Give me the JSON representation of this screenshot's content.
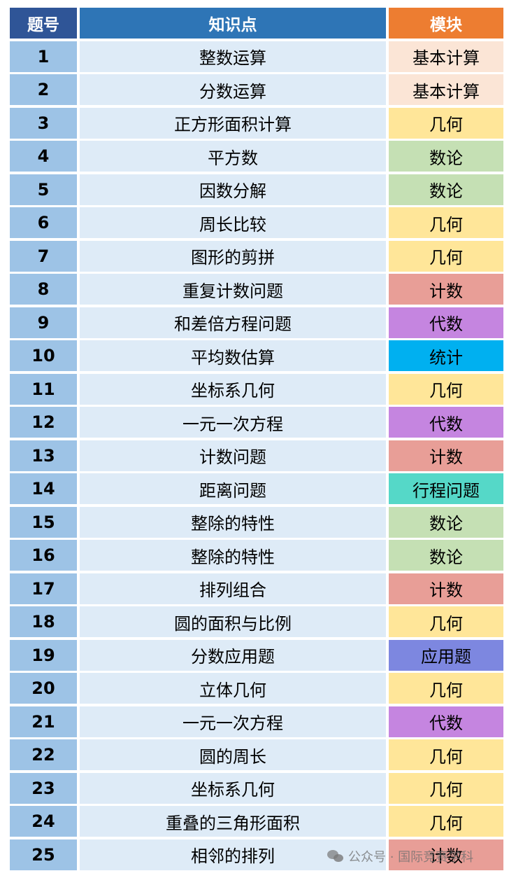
{
  "header": {
    "number": "题号",
    "topic": "知识点",
    "module": "模块"
  },
  "module_colors": {
    "基本计算": "#fbe5d6",
    "几何": "#ffe699",
    "数论": "#c5e0b4",
    "计数": "#e89e97",
    "代数": "#c585e0",
    "统计": "#00b0f0",
    "行程问题": "#55d8c8",
    "应用题": "#7d87e0"
  },
  "rows": [
    {
      "number": "1",
      "topic": "整数运算",
      "module": "基本计算"
    },
    {
      "number": "2",
      "topic": "分数运算",
      "module": "基本计算"
    },
    {
      "number": "3",
      "topic": "正方形面积计算",
      "module": "几何"
    },
    {
      "number": "4",
      "topic": "平方数",
      "module": "数论"
    },
    {
      "number": "5",
      "topic": "因数分解",
      "module": "数论"
    },
    {
      "number": "6",
      "topic": "周长比较",
      "module": "几何"
    },
    {
      "number": "7",
      "topic": "图形的剪拼",
      "module": "几何"
    },
    {
      "number": "8",
      "topic": "重复计数问题",
      "module": "计数"
    },
    {
      "number": "9",
      "topic": "和差倍方程问题",
      "module": "代数"
    },
    {
      "number": "10",
      "topic": "平均数估算",
      "module": "统计"
    },
    {
      "number": "11",
      "topic": "坐标系几何",
      "module": "几何"
    },
    {
      "number": "12",
      "topic": "一元一次方程",
      "module": "代数"
    },
    {
      "number": "13",
      "topic": "计数问题",
      "module": "计数"
    },
    {
      "number": "14",
      "topic": "距离问题",
      "module": "行程问题"
    },
    {
      "number": "15",
      "topic": "整除的特性",
      "module": "数论"
    },
    {
      "number": "16",
      "topic": "整除的特性",
      "module": "数论"
    },
    {
      "number": "17",
      "topic": "排列组合",
      "module": "计数"
    },
    {
      "number": "18",
      "topic": "圆的面积与比例",
      "module": "几何"
    },
    {
      "number": "19",
      "topic": "分数应用题",
      "module": "应用题"
    },
    {
      "number": "20",
      "topic": "立体几何",
      "module": "几何"
    },
    {
      "number": "21",
      "topic": "一元一次方程",
      "module": "代数"
    },
    {
      "number": "22",
      "topic": "圆的周长",
      "module": "几何"
    },
    {
      "number": "23",
      "topic": "坐标系几何",
      "module": "几何"
    },
    {
      "number": "24",
      "topic": "重叠的三角形面积",
      "module": "几何"
    },
    {
      "number": "25",
      "topic": "相邻的排列",
      "module": "计数"
    }
  ],
  "watermark": {
    "text": "公众号 · 国际竞赛学科"
  }
}
